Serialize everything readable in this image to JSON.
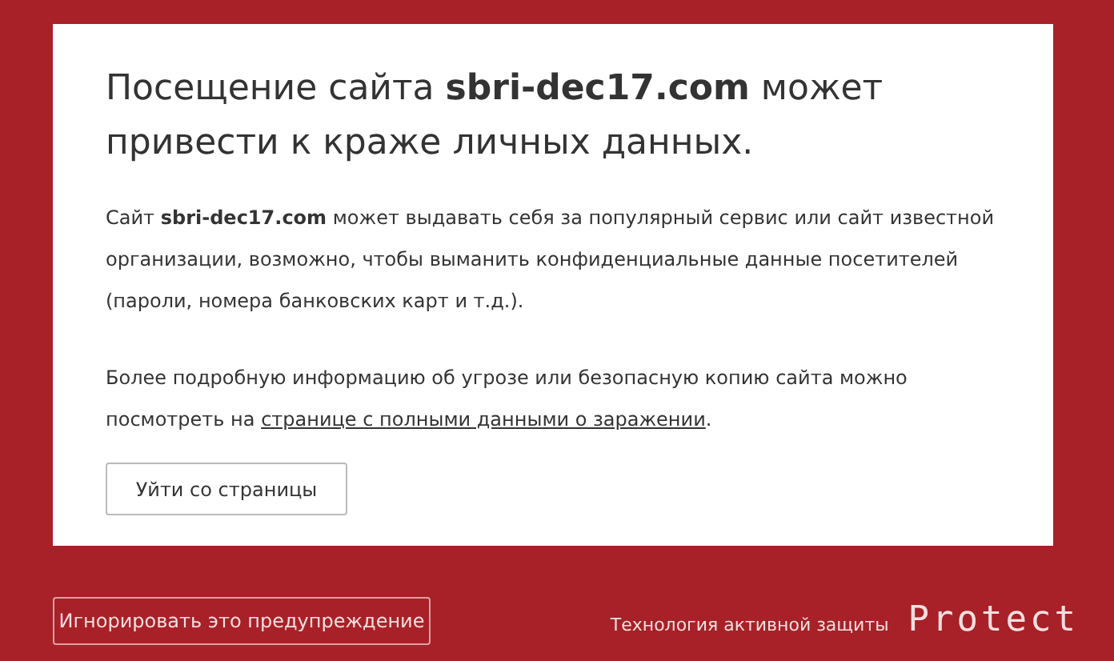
{
  "warning": {
    "title": "Посещение сайта **sbri-dec17.com** может привести к краже личных данных.",
    "description": "Сайт **sbri-dec17.com** может выдавать себя за популярный сервис или сайт известной организации, возможно, чтобы выманить конфиденциальные данные посетителей (пароли, номера банковских карт и т.д.).",
    "details": {
      "before": "Более подробную информацию об угрозе или безопасную копию сайта можно посмотреть на ",
      "link": "странице с полными данными о заражении",
      "after": "."
    },
    "leave_button": "Уйти со страницы"
  },
  "footer": {
    "ignore_button": "Игнорировать это предупреждение",
    "tagline": "Технология активной защиты",
    "logo": "Protect"
  }
}
